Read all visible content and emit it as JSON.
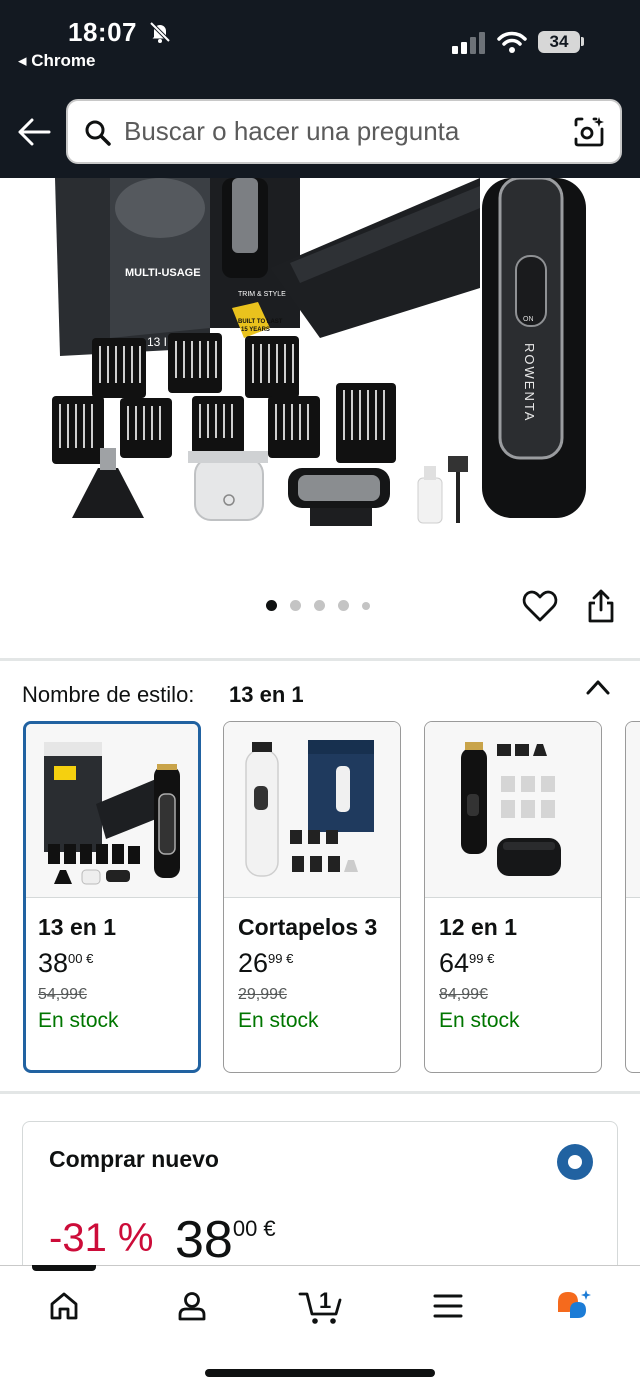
{
  "status_bar": {
    "time": "18:07",
    "back_app": "◂ Chrome",
    "battery": "34"
  },
  "header": {
    "search_placeholder": "Buscar o hacer una pregunta"
  },
  "product_image": {
    "box_text_1": "MULTI-USAGE",
    "box_text_2": "13 IN",
    "box_text_3": "TRIM & STYLE",
    "badge_text_1": "BUILT TO LAST",
    "badge_text_2": "15 YEARS",
    "brand": "ROWENTA",
    "switch_label": "ON"
  },
  "gallery": {
    "image_count": 5,
    "active_index": 0
  },
  "style_selector": {
    "label": "Nombre de estilo:",
    "value": "13 en 1"
  },
  "variants": [
    {
      "name": "13 en 1",
      "price_whole": "38",
      "price_frac": "00 €",
      "old_price": "54,99€",
      "stock": "En stock",
      "selected": true
    },
    {
      "name": "Cortapelos 3",
      "price_whole": "26",
      "price_frac": "99 €",
      "old_price": "29,99€",
      "stock": "En stock",
      "selected": false
    },
    {
      "name": "12 en 1",
      "price_whole": "64",
      "price_frac": "99 €",
      "old_price": "84,99€",
      "stock": "En stock",
      "selected": false
    }
  ],
  "buy_box": {
    "title": "Comprar nuevo",
    "discount": "-31 %",
    "price_whole": "38",
    "price_frac": "00 €"
  },
  "bottom_nav": {
    "cart_count": "1",
    "items": [
      "home-icon",
      "account-icon",
      "cart-icon",
      "menu-icon",
      "assistant-icon"
    ]
  },
  "colors": {
    "header_bg": "#131921",
    "link_blue": "#2162a1",
    "stock_green": "#007600",
    "discount_red": "#cc0c39"
  }
}
